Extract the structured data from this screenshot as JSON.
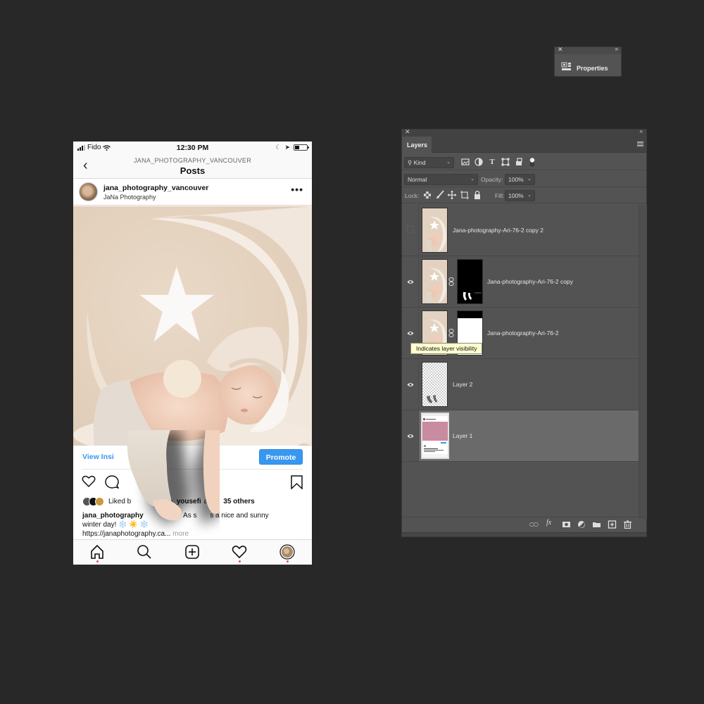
{
  "phone": {
    "status_bar": {
      "carrier": "Fido",
      "time": "12:30 PM"
    },
    "nav_header": {
      "account": "JANA_PHOTOGRAPHY_VANCOUVER",
      "title": "Posts"
    },
    "post": {
      "username": "jana_photography_vancouver",
      "subtitle": "JaNa Photography",
      "more_icon": "…",
      "view_insights": "View Insi",
      "promote_label": "Promote",
      "likes_prefix": "Liked b",
      "likes_user": "m_yousefi",
      "likes_mid": " a",
      "likes_suffix": "35 others",
      "caption_user": "jana_photography",
      "caption_text_visible": "r As s",
      "caption_text_end": "s a nice and sunny",
      "caption_line2": "winter day! ❄️ ☀️ ❄️",
      "caption_link": "https://janaphotography.ca...",
      "caption_more": "more"
    },
    "tab_bar": {
      "tabs": [
        "home-icon",
        "search-icon",
        "new-post-icon",
        "activity-heart-icon",
        "profile-avatar-icon"
      ]
    },
    "colors": {
      "accent_blue": "#3897f0",
      "notification_red": "#ed4956"
    }
  },
  "properties_panel": {
    "label": "Properties"
  },
  "layers_panel": {
    "tab_label": "Layers",
    "filter": {
      "kind_label": "Kind"
    },
    "blend_mode": "Normal",
    "opacity_label": "Opacity:",
    "opacity_value": "100%",
    "lock_label": "Lock:",
    "fill_label": "Fill:",
    "fill_value": "100%",
    "layers": [
      {
        "name": "Jana-photography-Ari-76-2 copy 2",
        "visible": false,
        "has_mask": false,
        "selected": false
      },
      {
        "name": "Jana-photography-Ari-76-2 copy",
        "visible": true,
        "has_mask": true,
        "selected": false
      },
      {
        "name": "Jana-photography-Ari-76-2",
        "visible": true,
        "has_mask": true,
        "selected": false
      },
      {
        "name": "Layer 2",
        "visible": true,
        "has_mask": false,
        "selected": false
      },
      {
        "name": "Layer 1",
        "visible": true,
        "has_mask": false,
        "selected": true
      }
    ],
    "tooltip": "Indicates layer visibility",
    "bottom_icons": [
      "link-layers-icon",
      "fx-icon",
      "add-mask-icon",
      "adjustment-layer-icon",
      "new-group-icon",
      "new-layer-icon",
      "delete-icon"
    ]
  }
}
